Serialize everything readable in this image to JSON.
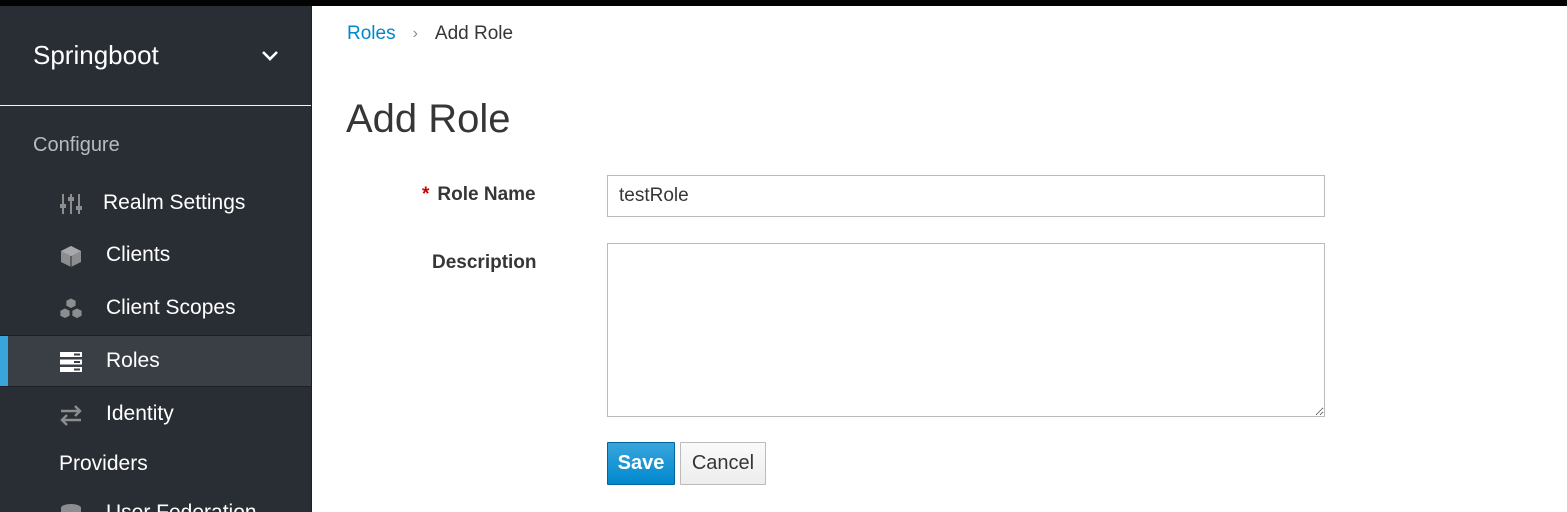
{
  "sidebar": {
    "realm_name": "Springboot",
    "section_label": "Configure",
    "items": [
      {
        "label": "Realm Settings",
        "icon": "sliders-icon"
      },
      {
        "label": "Clients",
        "icon": "cube-icon"
      },
      {
        "label": "Client Scopes",
        "icon": "cubes-icon"
      },
      {
        "label": "Roles",
        "icon": "server-icon"
      },
      {
        "label": "Identity",
        "icon": "exchange-icon"
      },
      {
        "label": "Providers",
        "icon": ""
      },
      {
        "label": "User Federation",
        "icon": "database-icon"
      }
    ],
    "active_item": "Roles"
  },
  "breadcrumb": {
    "parent": "Roles",
    "separator": "›",
    "current": "Add Role"
  },
  "page": {
    "title": "Add Role"
  },
  "form": {
    "role_name_required_marker": "*",
    "role_name_label": "Role Name",
    "role_name_value": "testRole",
    "description_label": "Description",
    "description_value": "",
    "save_label": "Save",
    "cancel_label": "Cancel"
  },
  "colors": {
    "sidebar_bg": "#292e34",
    "active_bg": "#393f44",
    "active_accent": "#39a5dc",
    "link": "#0088ce",
    "primary_button": "#0088ce",
    "required": "#cc0000"
  }
}
